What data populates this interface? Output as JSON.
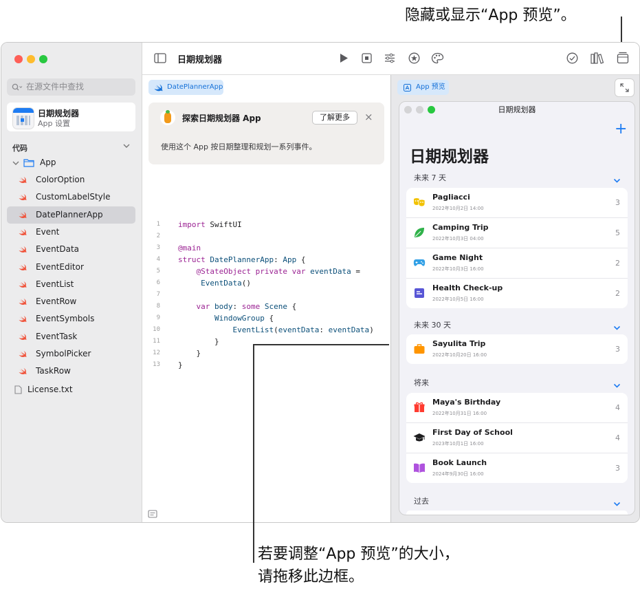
{
  "callouts": {
    "top": "隐藏或显示“App 预览”。",
    "bottom_line1": "若要调整“App 预览”的大小，",
    "bottom_line2": "请拖移此边框。"
  },
  "sidebar": {
    "search_placeholder": "在源文件中查找",
    "app_card": {
      "title": "日期规划器",
      "subtitle": "App 设置"
    },
    "section_label": "代码",
    "folder": "App",
    "files": [
      "ColorOption",
      "CustomLabelStyle",
      "DatePlannerApp",
      "Event",
      "EventData",
      "EventEditor",
      "EventList",
      "EventRow",
      "EventSymbols",
      "EventTask",
      "SymbolPicker",
      "TaskRow"
    ],
    "selected_file": "DatePlannerApp",
    "extra_file": "License.txt"
  },
  "toolbar": {
    "title": "日期规划器"
  },
  "editor": {
    "tab": "DatePlannerApp",
    "banner": {
      "title": "探索日期规划器 App",
      "button": "了解更多",
      "close": "×",
      "body": "使用这个 App 按日期整理和规划一系列事件。"
    },
    "line_numbers": [
      "1",
      "2",
      "3",
      "4",
      "5",
      "",
      "6",
      "7",
      "8",
      "9",
      "10",
      "11",
      "12",
      "13"
    ]
  },
  "preview": {
    "tab": "App 预览",
    "window_title": "日期规划器",
    "add_symbol": "+",
    "heading": "日期规划器",
    "groups": [
      {
        "header": "未来 7 天",
        "rows": [
          {
            "title": "Pagliacci",
            "date": "2022年10月2日 14:00",
            "count": "3",
            "icon": "theater-masks-icon",
            "color": "#f2c200"
          },
          {
            "title": "Camping Trip",
            "date": "2022年10月3日 04:00",
            "count": "5",
            "icon": "leaf-icon",
            "color": "#30b24a"
          },
          {
            "title": "Game Night",
            "date": "2022年10月3日 16:00",
            "count": "2",
            "icon": "gamecontroller-icon",
            "color": "#32a0e6"
          },
          {
            "title": "Health Check-up",
            "date": "2022年10月5日 16:00",
            "count": "2",
            "icon": "medical-card-icon",
            "color": "#5856d6"
          }
        ]
      },
      {
        "header": "未来 30 天",
        "rows": [
          {
            "title": "Sayulita Trip",
            "date": "2022年10月20日 16:00",
            "count": "3",
            "icon": "suitcase-icon",
            "color": "#ff9500"
          }
        ]
      },
      {
        "header": "将来",
        "rows": [
          {
            "title": "Maya's Birthday",
            "date": "2022年10月31日 16:00",
            "count": "4",
            "icon": "gift-icon",
            "color": "#ff3b30"
          },
          {
            "title": "First Day of School",
            "date": "2023年10月1日 16:00",
            "count": "4",
            "icon": "graduationcap-icon",
            "color": "#1d1d1f"
          },
          {
            "title": "Book Launch",
            "date": "2024年9月30日 16:00",
            "count": "3",
            "icon": "book-icon",
            "color": "#af52de"
          }
        ]
      },
      {
        "header": "过去",
        "rows": []
      }
    ]
  }
}
